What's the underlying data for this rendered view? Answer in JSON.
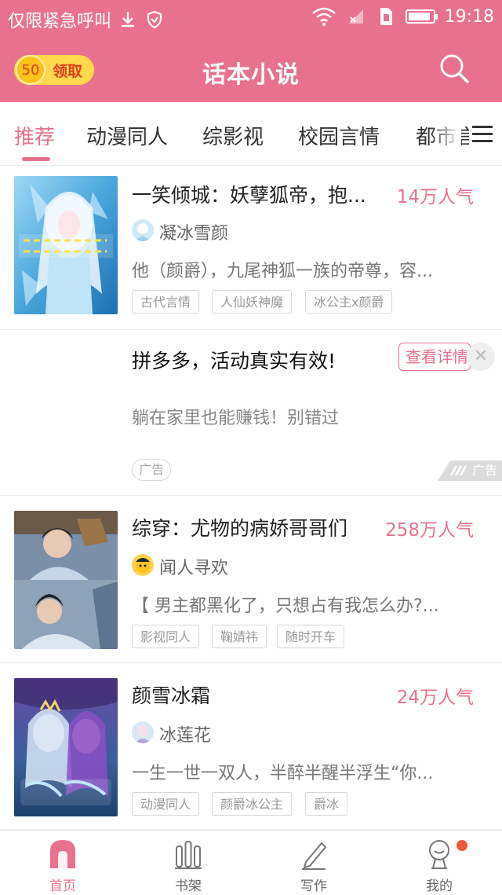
{
  "status_bar": {
    "carrier": "仅限紧急呼叫",
    "time": "19:18",
    "battery_level": 0.9
  },
  "header": {
    "coin_value": "50",
    "claim_label": "领取",
    "title": "话本小说",
    "search_icon": "search-icon"
  },
  "tabs": [
    "推荐",
    "动漫同人",
    "综影视",
    "校园言情",
    "都市言"
  ],
  "books": [
    {
      "title": "一笑倾城：妖孽狐帝，抱...",
      "popularity": "14万人气",
      "author": "凝冰雪颜",
      "description": "他（颜爵），九尾神狐一族的帝尊，容...",
      "tags": [
        "古代言情",
        "人仙妖神魔",
        "冰公主x颜爵"
      ]
    },
    {
      "title": "综穿：尤物的病娇哥哥们",
      "popularity": "258万人气",
      "author": "闻人寻欢",
      "description": "【 男主都黑化了，只想占有我怎么办?...",
      "tags": [
        "影视同人",
        "鞠婧祎",
        "随时开车"
      ]
    },
    {
      "title": "颜雪冰霜",
      "popularity": "24万人气",
      "author": "冰莲花",
      "description": "一生一世一双人，半醉半醒半浮生“你...",
      "tags": [
        "动漫同人",
        "颜爵冰公主",
        "爵冰"
      ]
    }
  ],
  "ad": {
    "title": "拼多多，活动真实有效!",
    "detail_button": "查看详情",
    "description": "躺在家里也能赚钱！别错过",
    "badge": "广告",
    "corner_label": "广告"
  },
  "bottom_nav": [
    {
      "label": "首页",
      "icon": "home-icon",
      "active": true
    },
    {
      "label": "书架",
      "icon": "bookshelf-icon",
      "active": false
    },
    {
      "label": "写作",
      "icon": "pen-icon",
      "active": false
    },
    {
      "label": "我的",
      "icon": "profile-icon",
      "active": false
    }
  ],
  "colors": {
    "brand_pink": "#e8728e",
    "coin_yellow": "#ffd84d",
    "notification_dot": "#e85b3b"
  }
}
